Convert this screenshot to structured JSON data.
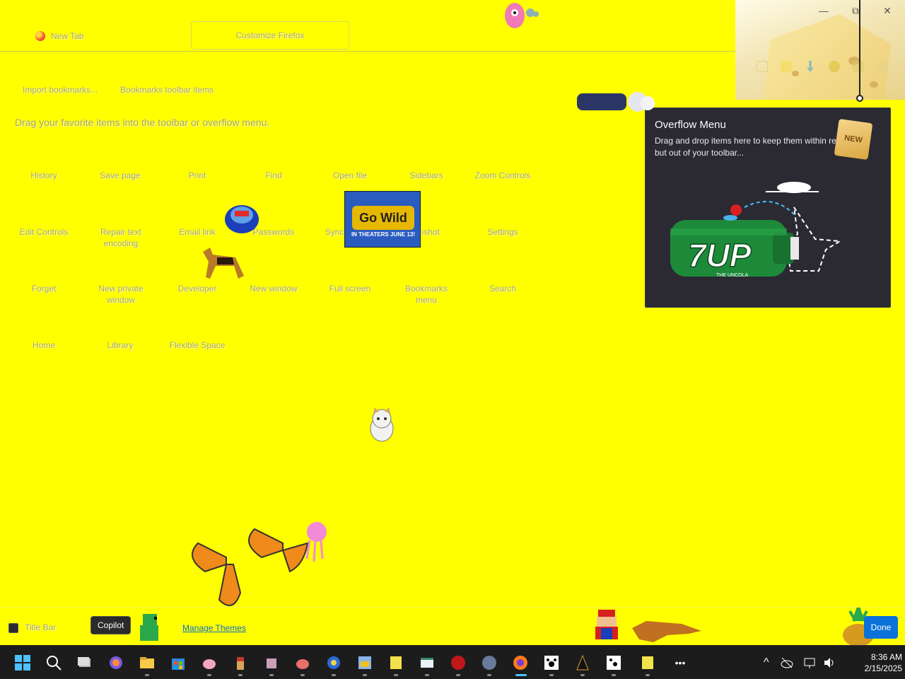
{
  "tabs": {
    "new_tab": "New Tab",
    "customize": "Customize Firefox"
  },
  "window_controls": {
    "minimize": "—",
    "restore": "⧉",
    "close": "✕"
  },
  "bookmarks": {
    "import": "Import bookmarks...",
    "toolbar_items": "Bookmarks toolbar items"
  },
  "drag_hint": "Drag your favorite items into the toolbar or overflow menu.",
  "palette": [
    "History",
    "Save page",
    "Print",
    "Find",
    "Open file",
    "Sidebars",
    "Zoom Controls",
    "Edit Controls",
    "Repair text encoding",
    "Email link",
    "Passwords",
    "Sync",
    "enshot",
    "Settings",
    "Forget",
    "New private window",
    "Developer",
    "New window",
    "Full screen",
    "Bookmarks menu",
    "Search",
    "Home",
    "Library",
    "Flexible Space"
  ],
  "overflow": {
    "title": "Overflow Menu",
    "description": "Drag and drop items here to keep them within reach but out of your toolbar...",
    "badge": "NEW",
    "illustration_text": "7UP",
    "illustration_subtext": "THE UNCOLA"
  },
  "poster": {
    "top": "Go Wild",
    "bottom": "IN THEATERS JUNE 13!"
  },
  "bottom_bar": {
    "title_bar_label": "Title Bar",
    "tooltip": "Copilot",
    "manage_themes": "Manage Themes",
    "done": "Done"
  },
  "taskbar": {
    "icons": [
      "windows-start",
      "search",
      "task-view",
      "copilot",
      "file-explorer",
      "microsoft-store",
      "app-pig",
      "app-pirate",
      "app-robot",
      "app-bug",
      "app-diver",
      "app-car",
      "app-spongebob",
      "app-window",
      "app-dragon",
      "app-dog",
      "firefox",
      "paw-app",
      "app-black",
      "paw-app-2",
      "app-spongebob-2"
    ],
    "overflow": "•••",
    "clock_time": "8:36 AM",
    "clock_date": "2/15/2025"
  },
  "colors": {
    "page_bg": "#ffff00",
    "panel_bg": "#2b2a33",
    "done_blue": "#0a72d8",
    "link_blue": "#0b6fc9"
  }
}
